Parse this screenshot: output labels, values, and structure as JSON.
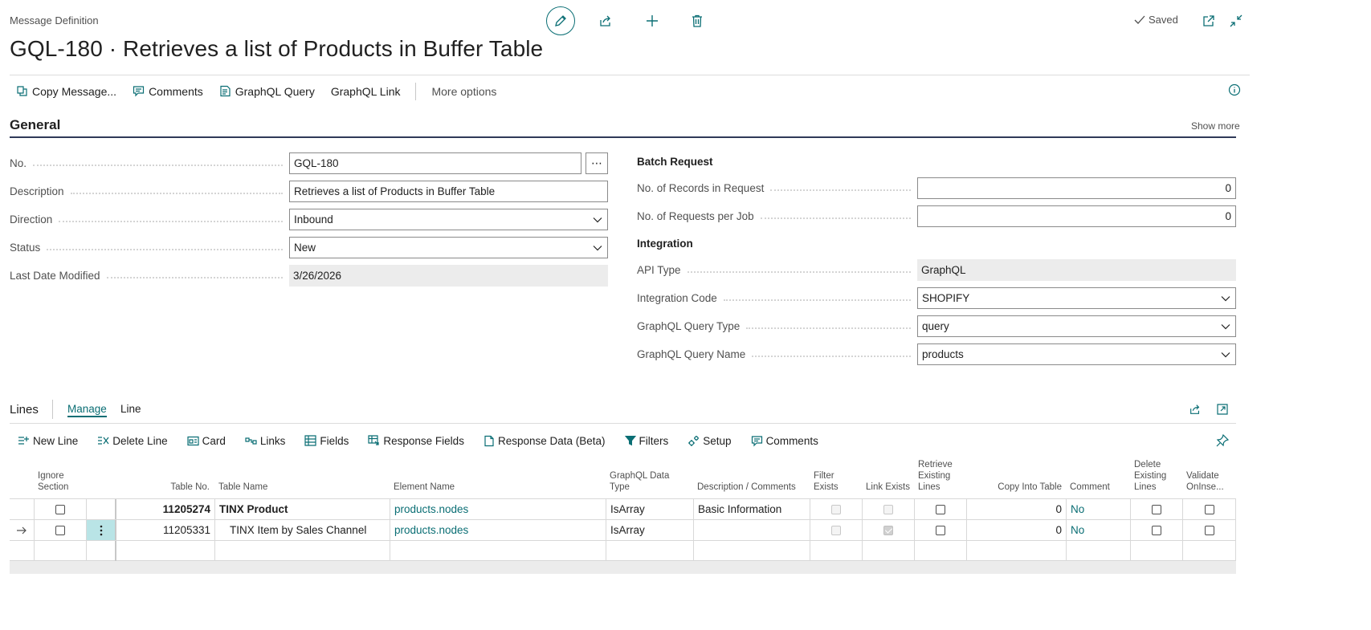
{
  "header": {
    "caption": "Message Definition",
    "title": "GQL-180 · Retrieves a list of Products in Buffer Table",
    "saved_label": "Saved"
  },
  "actions": {
    "copy_message": "Copy Message...",
    "comments": "Comments",
    "graphql_query": "GraphQL Query",
    "graphql_link": "GraphQL Link",
    "more_options": "More options"
  },
  "general": {
    "title": "General",
    "show_more": "Show more",
    "no_label": "No.",
    "no_value": "GQL-180",
    "description_label": "Description",
    "description_value": "Retrieves a list of Products in Buffer Table",
    "direction_label": "Direction",
    "direction_value": "Inbound",
    "status_label": "Status",
    "status_value": "New",
    "last_modified_label": "Last Date Modified",
    "last_modified_value": "3/26/2026",
    "batch_heading": "Batch Request",
    "records_label": "No. of Records in Request",
    "records_value": "0",
    "requests_label": "No. of Requests per Job",
    "requests_value": "0",
    "integration_heading": "Integration",
    "api_type_label": "API Type",
    "api_type_value": "GraphQL",
    "integration_code_label": "Integration Code",
    "integration_code_value": "SHOPIFY",
    "query_type_label": "GraphQL Query Type",
    "query_type_value": "query",
    "query_name_label": "GraphQL Query Name",
    "query_name_value": "products"
  },
  "lines": {
    "title": "Lines",
    "tab_manage": "Manage",
    "tab_line": "Line",
    "actions": {
      "new_line": "New Line",
      "delete_line": "Delete Line",
      "card": "Card",
      "links": "Links",
      "fields": "Fields",
      "response_fields": "Response Fields",
      "response_data": "Response Data (Beta)",
      "filters": "Filters",
      "setup": "Setup",
      "comments": "Comments"
    },
    "columns": {
      "ignore_section": "Ignore Section",
      "table_no": "Table No.",
      "table_name": "Table Name",
      "element_name": "Element Name",
      "graphql_data_type": "GraphQL Data Type",
      "description": "Description / Comments",
      "filter_exists": "Filter Exists",
      "link_exists": "Link Exists",
      "retrieve_existing": "Retrieve Existing Lines",
      "copy_into_table": "Copy Into Table",
      "comment": "Comment",
      "delete_existing": "Delete Existing Lines",
      "validate_oninsert": "Validate OnInse..."
    },
    "rows": [
      {
        "table_no": "11205274",
        "table_name": "TINX Product",
        "element_name": "products.nodes",
        "data_type": "IsArray",
        "description": "Basic Information",
        "filter_exists": false,
        "link_exists": false,
        "copy_into_table": "0",
        "comment": "No"
      },
      {
        "table_no": "11205331",
        "table_name": "TINX Item by Sales Channel",
        "element_name": "products.nodes",
        "data_type": "IsArray",
        "description": "",
        "filter_exists": false,
        "link_exists": true,
        "copy_into_table": "0",
        "comment": "No"
      }
    ]
  },
  "colors": {
    "accent": "#0a6e74",
    "section_rule": "#2f3a58",
    "selected_cell": "#b9e4e6"
  }
}
